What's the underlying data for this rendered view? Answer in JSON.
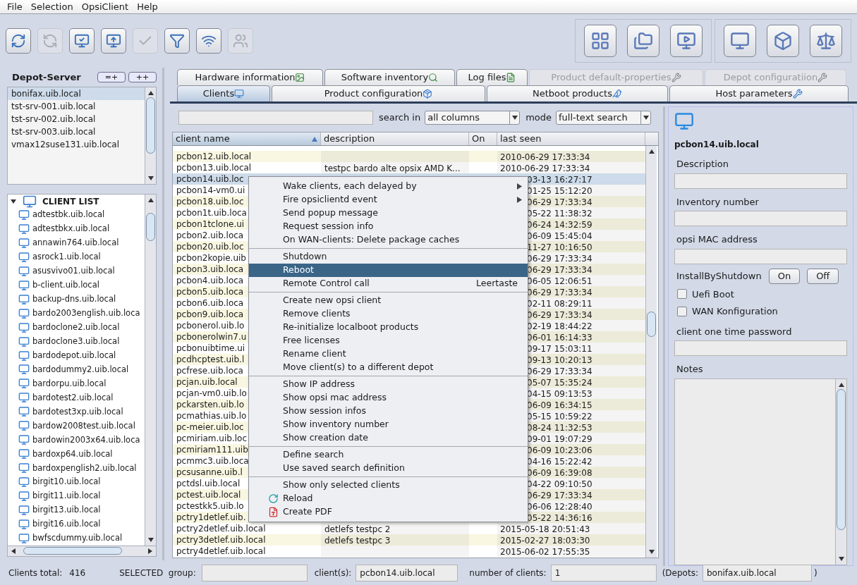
{
  "menubar": [
    "File",
    "Selection",
    "OpsiClient",
    "Help"
  ],
  "toolbar": {
    "left": [
      {
        "disabled": false
      },
      {
        "disabled": true
      },
      {
        "disabled": false
      },
      {
        "disabled": false
      },
      {
        "disabled": true
      },
      {
        "disabled": false
      },
      {
        "disabled": false
      },
      {
        "disabled": true
      }
    ]
  },
  "depot_server": {
    "title": "Depot-Server",
    "buttons": [
      "=+",
      "++"
    ],
    "items": [
      {
        "label": "bonifax.uib.local",
        "selected": true
      },
      {
        "label": "tst-srv-001.uib.local",
        "selected": false
      },
      {
        "label": "tst-srv-002.uib.local",
        "selected": false
      },
      {
        "label": "tst-srv-003.uib.local",
        "selected": false
      },
      {
        "label": "vmax12suse131.uib.local",
        "selected": false
      }
    ]
  },
  "tree": {
    "label": "CLIENT LIST",
    "expanded": true,
    "children": [
      "adtestbk.uib.local",
      "adtestbkx.uib.local",
      "annawin764.uib.local",
      "asrock1.uib.local",
      "asusvivo01.uib.local",
      "b-client.uib.local",
      "backup-dns.uib.local",
      "bardo2003english.uib.loca",
      "bardoclone2.uib.local",
      "bardoclone3.uib.local",
      "bardodepot.uib.local",
      "bardodummy2.uib.local",
      "bardorpu.uib.local",
      "bardotest2.uib.local",
      "bardotest3xp.uib.local",
      "bardow2008test.uib.local",
      "bardowin2003x64.uib.loca",
      "bardoxp64.uib.local",
      "bardoxpenglish2.uib.local",
      "birgit10.uib.local",
      "birgit11.uib.local",
      "birgit13.uib.local",
      "birgit16.uib.local",
      "bwfscdummy.uib.local"
    ]
  },
  "tabs_top": [
    {
      "label": "Hardware information",
      "disabled": false
    },
    {
      "label": "Software inventory",
      "disabled": false
    },
    {
      "label": "Log files",
      "disabled": false
    },
    {
      "label": "Product default-properties",
      "disabled": true
    },
    {
      "label": "Depot configuratiion",
      "disabled": true
    }
  ],
  "tabs": [
    {
      "label": "Clients",
      "selected": true
    },
    {
      "label": "Product configuration",
      "selected": false
    },
    {
      "label": "Netboot products",
      "selected": false
    },
    {
      "label": "Host parameters",
      "selected": false
    }
  ],
  "search": {
    "label": "search in",
    "scope": "all columns",
    "mode_label": "mode",
    "mode": "full-text search"
  },
  "table": {
    "columns": [
      {
        "label": "client name",
        "sorted": true
      },
      {
        "label": "description",
        "sorted": false
      },
      {
        "label": "On",
        "sorted": false
      },
      {
        "label": "last seen",
        "sorted": false
      }
    ],
    "rows": [
      {
        "kind": "full",
        "name": "pcbon12.uib.local",
        "last_seen": "2010-06-29 17:33:34",
        "selected": false
      },
      {
        "kind": "full",
        "name": "pcbon13.uib.local",
        "description": "testpc bardo alte opsix AMD K...",
        "last_seen": "2010-06-29 17:33:34",
        "selected": false
      },
      {
        "kind": "partial",
        "name": "pcbon14.uib.loc",
        "last_seen": "03-13 16:27:17",
        "selected": true
      },
      {
        "kind": "partial",
        "name": "pcbon14-vm0.ui",
        "last_seen": "01-25 15:12:20",
        "selected": false
      },
      {
        "kind": "partial",
        "name": "pcbon18.uib.loc",
        "last_seen": "06-29 17:33:34",
        "selected": false
      },
      {
        "kind": "partial",
        "name": "pcbon1t.uib.loca",
        "last_seen": "05-22 11:38:32",
        "selected": false
      },
      {
        "kind": "partial",
        "name": "pcbon1tclone.ui",
        "last_seen": "06-24 14:32:59",
        "selected": false
      },
      {
        "kind": "partial",
        "name": "pcbon2.uib.loca",
        "last_seen": "06-09 15:45:04",
        "selected": false
      },
      {
        "kind": "partial",
        "name": "pcbon20.uib.loc",
        "last_seen": "11-27 10:16:50",
        "selected": false
      },
      {
        "kind": "partial",
        "name": "pcbon2kopie.uib",
        "last_seen": "06-29 17:33:34",
        "selected": false
      },
      {
        "kind": "partial",
        "name": "pcbon3.uib.loca",
        "last_seen": "06-29 17:33:34",
        "selected": false
      },
      {
        "kind": "partial",
        "name": "pcbon4.uib.loca",
        "last_seen": "06-05 12:06:51",
        "selected": false
      },
      {
        "kind": "partial",
        "name": "pcbon5.uib.loca",
        "last_seen": "06-29 17:33:34",
        "selected": false
      },
      {
        "kind": "partial",
        "name": "pcbon6.uib.loca",
        "last_seen": "02-11 08:29:11",
        "selected": false
      },
      {
        "kind": "partial",
        "name": "pcbon9.uib.loca",
        "last_seen": "06-29 17:33:34",
        "selected": false
      },
      {
        "kind": "partial",
        "name": "pcbonerol.uib.lo",
        "last_seen": "02-19 18:44:22",
        "selected": false
      },
      {
        "kind": "partial",
        "name": "pcbonerolwin7.u",
        "last_seen": "06-01 16:14:33",
        "selected": false
      },
      {
        "kind": "partial",
        "name": "pcbonuibtime.ui",
        "last_seen": "09-17 15:03:11",
        "selected": false
      },
      {
        "kind": "partial",
        "name": "pcdhcptest.uib.l",
        "last_seen": "09-13 10:20:13",
        "selected": false
      },
      {
        "kind": "partial",
        "name": "pcfrese.uib.loca",
        "last_seen": "06-29 17:33:34",
        "selected": false
      },
      {
        "kind": "partial",
        "name": "pcjan.uib.local",
        "last_seen": "05-07 15:35:24",
        "selected": false
      },
      {
        "kind": "partial",
        "name": "pcjan-vm0.uib.lo",
        "last_seen": "04-15 09:13:53",
        "selected": false
      },
      {
        "kind": "partial",
        "name": "pckarsten.uib.lo",
        "last_seen": "06-09 16:34:15",
        "selected": false
      },
      {
        "kind": "partial",
        "name": "pcmathias.uib.lo",
        "last_seen": "05-15 10:59:22",
        "selected": false
      },
      {
        "kind": "partial",
        "name": "pc-meier.uib.loc",
        "last_seen": "08-24 11:32:53",
        "selected": false
      },
      {
        "kind": "partial",
        "name": "pcmiriam.uib.loc",
        "last_seen": "09-01 19:07:29",
        "selected": false
      },
      {
        "kind": "partial",
        "name": "pcmiriam111.uib",
        "last_seen": "06-09 10:23:06",
        "selected": false
      },
      {
        "kind": "partial",
        "name": "pcmmc3.uib.loca",
        "last_seen": "04-16 15:22:42",
        "selected": false
      },
      {
        "kind": "partial",
        "name": "pcsusanne.uib.l",
        "last_seen": "06-09 16:39:08",
        "selected": false
      },
      {
        "kind": "partial",
        "name": "pctdsl.uib.local",
        "last_seen": "04-22 09:10:50",
        "selected": false
      },
      {
        "kind": "partial",
        "name": "pctest.uib.local",
        "last_seen": "06-29 17:33:34",
        "selected": false
      },
      {
        "kind": "partial",
        "name": "pctestkk5.uib.lo",
        "last_seen": "06-06 12:28:40",
        "selected": false
      },
      {
        "kind": "partial",
        "name": "pctry1detlef.uib.",
        "last_seen": "05-22 14:36:16",
        "selected": false
      },
      {
        "kind": "full",
        "name": "pctry2detlef.uib.local",
        "description": "detlefs testpc 2",
        "last_seen": "2015-05-18 20:51:43",
        "selected": false
      },
      {
        "kind": "full",
        "name": "pctry3detlef.uib.local",
        "description": "detlefs testpc 3",
        "last_seen": "2015-02-27 18:03:30",
        "selected": false
      },
      {
        "kind": "full",
        "name": "pctry4detlef.uib.local",
        "last_seen": "2015-06-02 17:55:35",
        "selected": false
      }
    ]
  },
  "context_menu": [
    [
      {
        "label": "Wake clients, each delayed by",
        "submenu": true,
        "selected": false
      },
      {
        "label": "Fire opsiclientd event",
        "submenu": true,
        "selected": false
      },
      {
        "label": "Send popup message",
        "submenu": false,
        "selected": false
      },
      {
        "label": "Request session info",
        "submenu": false,
        "selected": false
      },
      {
        "label": "On WAN-clients: Delete package caches",
        "submenu": false,
        "selected": false
      }
    ],
    [
      {
        "label": "Shutdown",
        "submenu": false,
        "selected": false
      },
      {
        "label": "Reboot",
        "submenu": false,
        "selected": true
      },
      {
        "label": "Remote Control call",
        "shortcut": "Leertaste",
        "submenu": false,
        "selected": false
      }
    ],
    [
      {
        "label": "Create new opsi client",
        "submenu": false,
        "selected": false
      },
      {
        "label": "Remove clients",
        "submenu": false,
        "selected": false
      },
      {
        "label": "Re-initialize localboot products",
        "submenu": false,
        "selected": false
      },
      {
        "label": "Free licenses",
        "submenu": false,
        "selected": false
      },
      {
        "label": "Rename client",
        "submenu": false,
        "selected": false
      },
      {
        "label": "Move client(s) to a different depot",
        "submenu": false,
        "selected": false
      }
    ],
    [
      {
        "label": "Show IP address",
        "submenu": false,
        "selected": false
      },
      {
        "label": "Show opsi mac address",
        "submenu": false,
        "selected": false
      },
      {
        "label": "Show session infos",
        "submenu": false,
        "selected": false
      },
      {
        "label": "Show inventory number",
        "submenu": false,
        "selected": false
      },
      {
        "label": "Show creation date",
        "submenu": false,
        "selected": false
      }
    ],
    [
      {
        "label": "Define search",
        "submenu": false,
        "selected": false
      },
      {
        "label": "Use saved search definition",
        "submenu": false,
        "selected": false
      }
    ],
    [
      {
        "label": "Show only selected clients",
        "kind": "plain",
        "submenu": false,
        "selected": false
      },
      {
        "label": "Reload",
        "kind": "reload",
        "submenu": false,
        "selected": false
      },
      {
        "label": "Create PDF",
        "kind": "pdf",
        "submenu": false,
        "selected": false
      }
    ]
  ],
  "client_panel": {
    "name": "pcbon14.uib.local",
    "fields": [
      {
        "label": "Description"
      },
      {
        "label": "Inventory number"
      },
      {
        "label": "opsi MAC address"
      }
    ],
    "install_by_shutdown": {
      "label": "InstallByShutdown",
      "buttons": [
        "On",
        "Off"
      ]
    },
    "checkboxes": [
      {
        "label": "Uefi Boot",
        "checked": false
      },
      {
        "label": "WAN Konfiguration",
        "checked": false
      }
    ],
    "password_label": "client one time password",
    "notes_label": "Notes"
  },
  "status_bar": {
    "total_label": "Clients total:",
    "total": "416",
    "group_label": "SELECTED  group:",
    "clients_label": "client(s):",
    "clients_value": "pcbon14.uib.local",
    "count_label": "number of clients:",
    "count_value": "1",
    "depots_label": "(Depots:",
    "depots_value": "bonifax.uib.local",
    "depots_close": ")"
  }
}
